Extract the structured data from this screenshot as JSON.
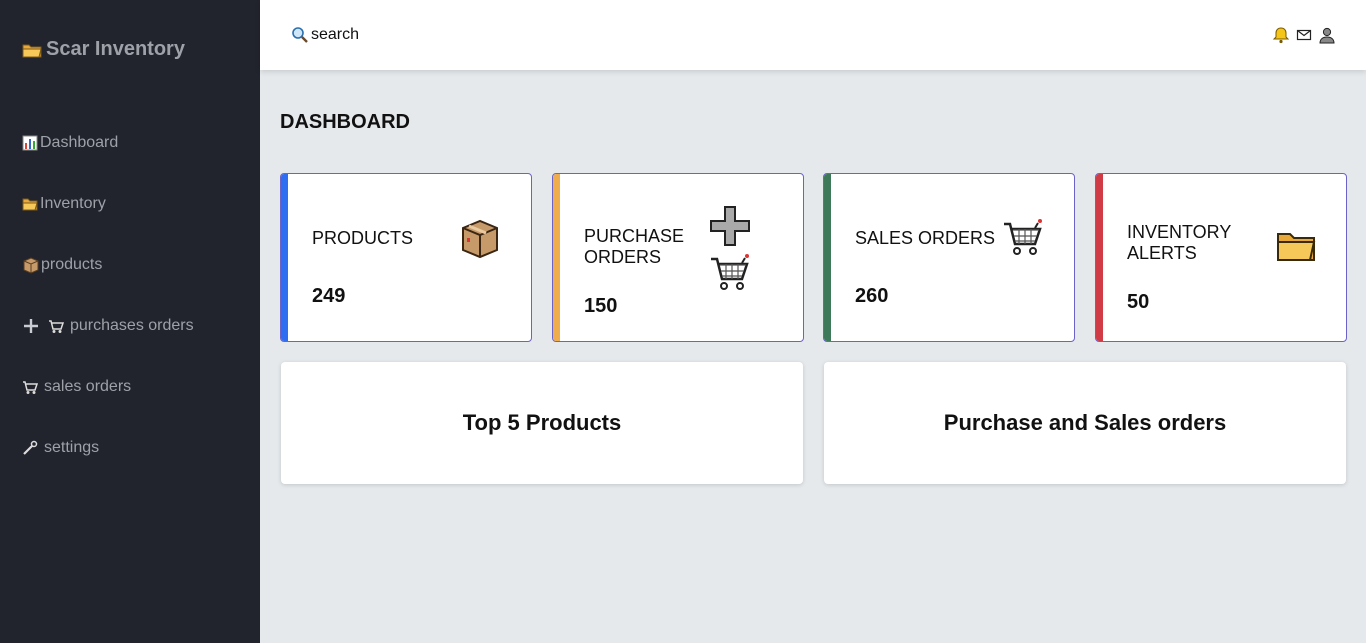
{
  "brand": {
    "icon": "folder-icon",
    "name": "Scar Inventory"
  },
  "sidebar": {
    "items": [
      {
        "icon": "bar-chart-icon",
        "label": "Dashboard"
      },
      {
        "icon": "folder-icon",
        "label": "Inventory"
      },
      {
        "icon": "package-icon",
        "label": "products"
      },
      {
        "icon": "plus-cart-icon",
        "label": "purchases orders"
      },
      {
        "icon": "cart-icon",
        "label": "sales orders"
      },
      {
        "icon": "wrench-icon",
        "label": "settings"
      }
    ]
  },
  "header": {
    "search_label": "search",
    "icons": [
      "bell-icon",
      "mail-icon",
      "user-icon"
    ]
  },
  "page": {
    "title": "DASHBOARD"
  },
  "cards": [
    {
      "label": "PRODUCTS",
      "value": "249",
      "icon": "package-icon",
      "accent": "#2f6ef0"
    },
    {
      "label": "PURCHASE ORDERS",
      "value": "150",
      "icon": "plus-cart-icon",
      "accent": "#f0ad4e"
    },
    {
      "label": "SALES ORDERS",
      "value": "260",
      "icon": "cart-icon",
      "accent": "#3e7a59"
    },
    {
      "label": "INVENTORY ALERTS",
      "value": "50",
      "icon": "folder-icon",
      "accent": "#d13b45"
    }
  ],
  "panels": [
    {
      "title": "Top 5 Products"
    },
    {
      "title": "Purchase and Sales orders"
    }
  ]
}
